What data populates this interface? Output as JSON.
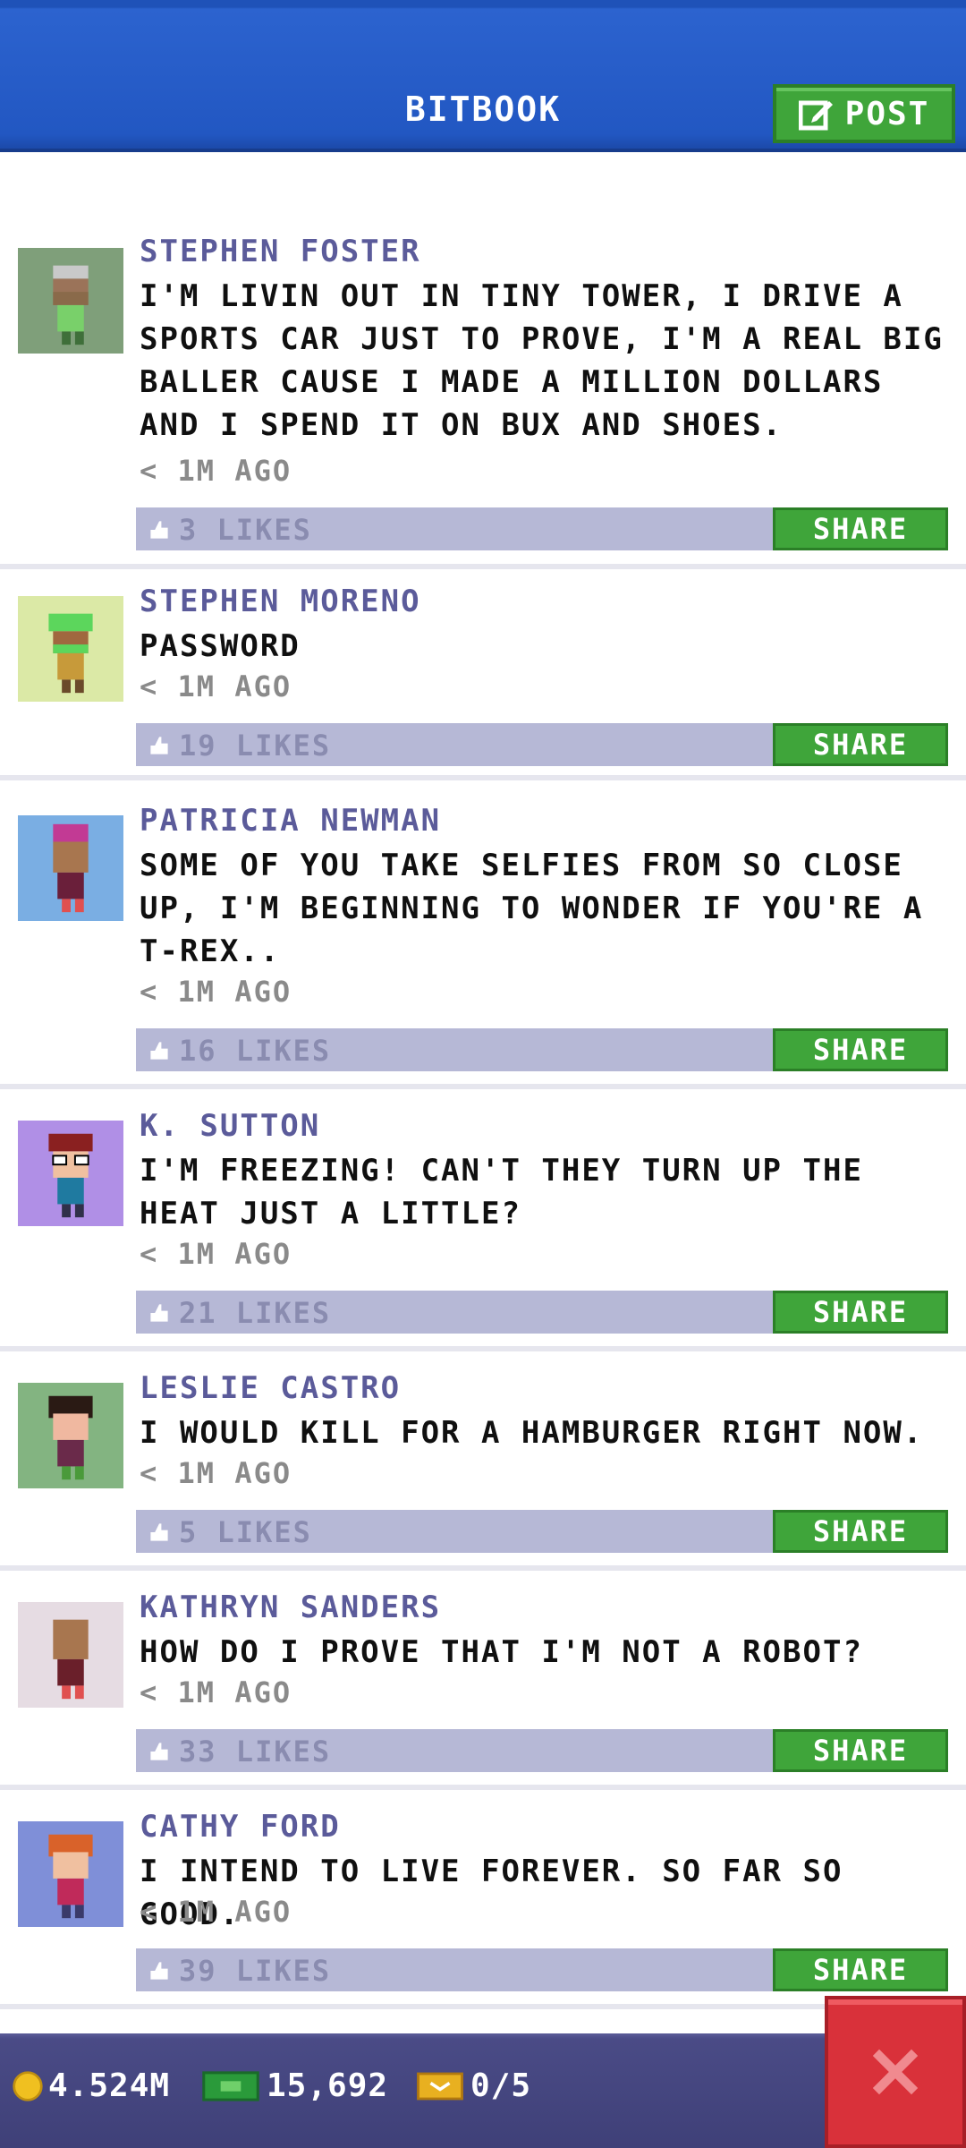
{
  "header": {
    "title": "BITBOOK",
    "post_label": "POST"
  },
  "posts": [
    {
      "name": "STEPHEN FOSTER",
      "text": "I'M LIVIN OUT IN TINY TOWER, I DRIVE A SPORTS CAR JUST TO PROVE, I'M A REAL BIG BALLER CAUSE I MADE A MILLION DOLLARS AND I SPEND IT ON BUX AND SHOES.",
      "time": "< 1M AGO",
      "likes": "3 LIKES",
      "avatar_bg": "#7f9f7a"
    },
    {
      "name": "STEPHEN MORENO",
      "text": "PASSWORD",
      "time": "< 1M AGO",
      "likes": "19 LIKES",
      "avatar_bg": "#dbe9a6"
    },
    {
      "name": "PATRICIA NEWMAN",
      "text": "SOME OF YOU TAKE SELFIES FROM SO CLOSE UP, I'M BEGINNING TO WONDER IF YOU'RE A T-REX..",
      "time": "< 1M AGO",
      "likes": "16 LIKES",
      "avatar_bg": "#7aaee3"
    },
    {
      "name": "K. SUTTON",
      "text": "I'M FREEZING! CAN'T THEY TURN UP THE HEAT JUST A LITTLE?",
      "time": "< 1M AGO",
      "likes": "21 LIKES",
      "avatar_bg": "#b08fe6"
    },
    {
      "name": "LESLIE CASTRO",
      "text": "I WOULD KILL FOR A HAMBURGER RIGHT NOW.",
      "time": "< 1M AGO",
      "likes": "5 LIKES",
      "avatar_bg": "#83b481"
    },
    {
      "name": "KATHRYN SANDERS",
      "text": "HOW DO I PROVE THAT I'M NOT A ROBOT?",
      "time": "< 1M AGO",
      "likes": "33 LIKES",
      "avatar_bg": "#e6dce3"
    },
    {
      "name": "CATHY FORD",
      "text": "I INTEND TO LIVE FOREVER. SO FAR SO GOOD.",
      "time": "< 1M AGO",
      "likes": "39 LIKES",
      "avatar_bg": "#7f8fd8"
    }
  ],
  "share_label": "SHARE",
  "status_bar": {
    "coins": "4.524M",
    "bux": "15,692",
    "tickets": "0/5"
  },
  "colors": {
    "header_blue": "#2257c2",
    "accent_green": "#3fa53a",
    "like_bar": "#b6b8d6",
    "name_purple": "#5b5b9a",
    "close_red": "#d9313a"
  }
}
